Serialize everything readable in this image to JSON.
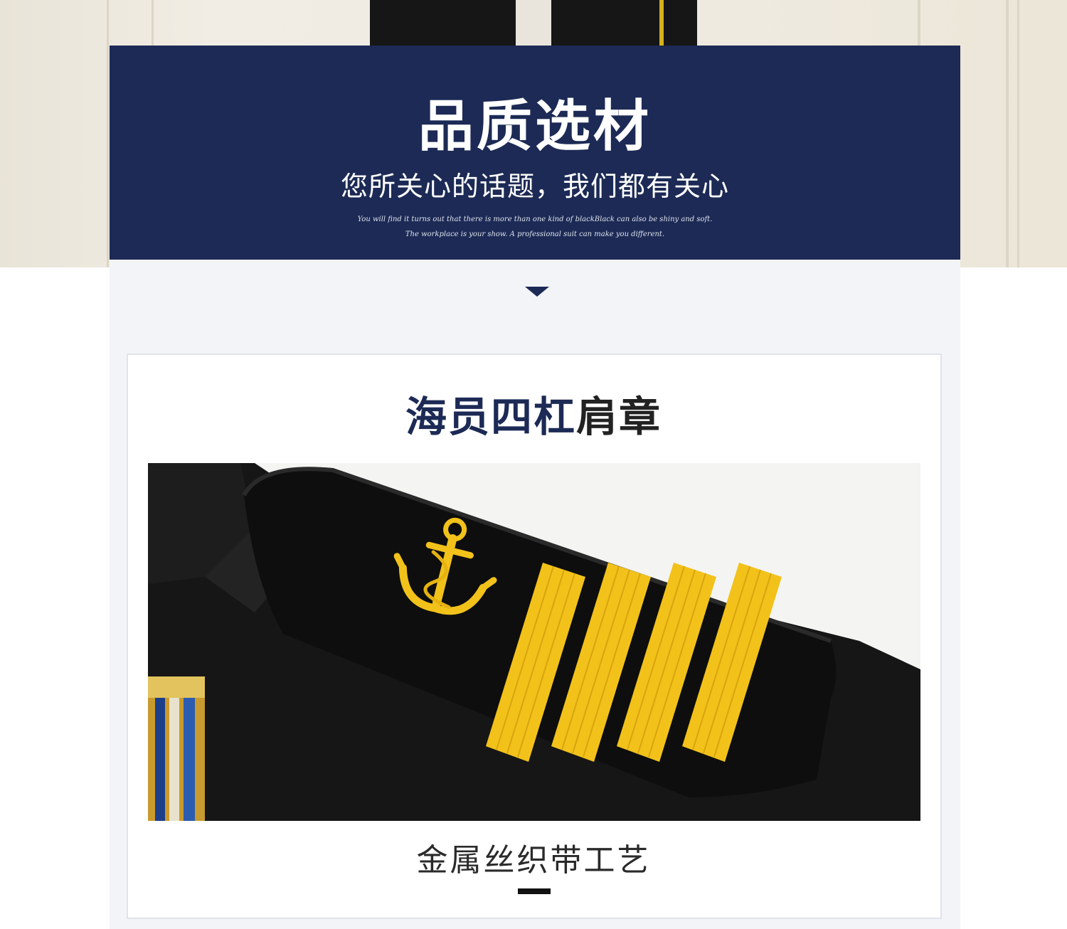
{
  "banner": {
    "title": "品质选材",
    "subtitle": "您所关心的话题，我们都有关心",
    "english_line_1": "You will find it turns out that there is more than one kind of blackBlack can also be shiny and soft.",
    "english_line_2": "The workplace is your show. A professional suit can make you different."
  },
  "product": {
    "title_highlight": "海员四杠",
    "title_rest": "肩章",
    "caption": "金属丝织带工艺"
  },
  "colors": {
    "navy": "#1c2a55",
    "gold": "#f2c21a",
    "black": "#141414"
  },
  "icons": {
    "section_arrow": "triangle-down-icon",
    "anchor": "anchor-icon"
  },
  "epaulette": {
    "stripe_count": 4
  }
}
